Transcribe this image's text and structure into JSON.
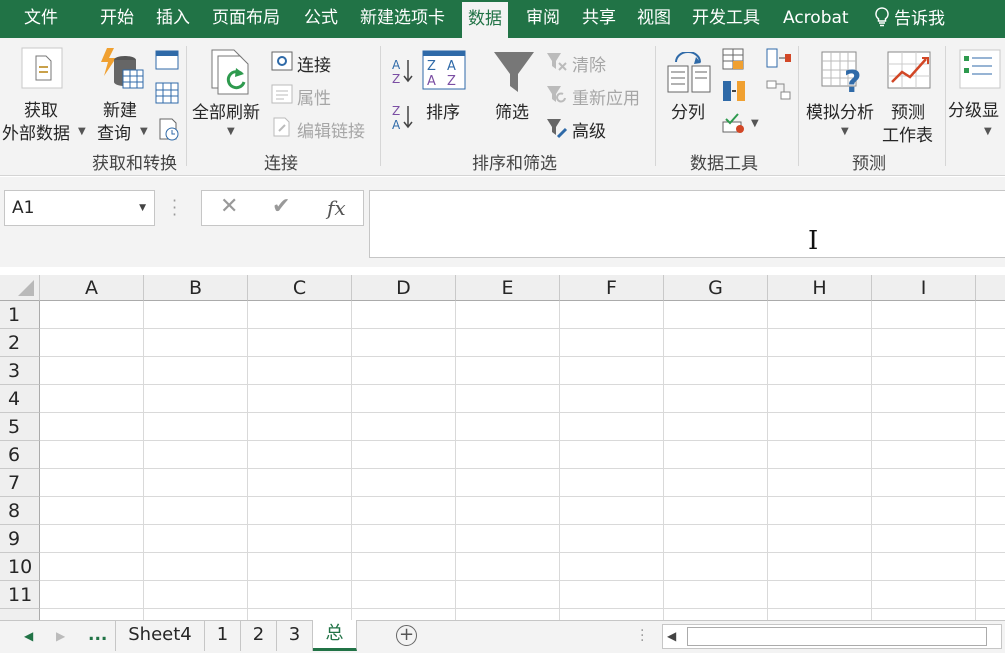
{
  "menu": {
    "tabs": [
      {
        "label": "文件"
      },
      {
        "label": "开始"
      },
      {
        "label": "插入"
      },
      {
        "label": "页面布局"
      },
      {
        "label": "公式"
      },
      {
        "label": "新建选项卡"
      },
      {
        "label": "数据"
      },
      {
        "label": "审阅"
      },
      {
        "label": "共享"
      },
      {
        "label": "视图"
      },
      {
        "label": "开发工具"
      },
      {
        "label": "Acrobat"
      }
    ],
    "active_tab": "数据",
    "tell_me": "告诉我"
  },
  "ribbon": {
    "get_external_data": "获取\n外部数据",
    "get_external_data_l1": "获取",
    "get_external_data_l2": "外部数据",
    "new_query_l1": "新建",
    "new_query_l2": "查询",
    "group_get_transform": "获取和转换",
    "refresh_all": "全部刷新",
    "connections": "连接",
    "properties": "属性",
    "edit_links": "编辑链接",
    "group_connections": "连接",
    "sort": "排序",
    "filter": "筛选",
    "clear": "清除",
    "reapply": "重新应用",
    "advanced": "高级",
    "group_sort_filter": "排序和筛选",
    "text_to_columns": "分列",
    "group_data_tools": "数据工具",
    "what_if_l1": "模拟分析",
    "forecast_l1": "预测",
    "forecast_l2": "工作表",
    "group_forecast": "预测",
    "outline": "分级显",
    "accent": "#217346"
  },
  "formula_bar": {
    "name_box": "A1",
    "formula": ""
  },
  "grid": {
    "columns": [
      "A",
      "B",
      "C",
      "D",
      "E",
      "F",
      "G",
      "H",
      "I"
    ],
    "rows": [
      "1",
      "2",
      "3",
      "4",
      "5",
      "6",
      "7",
      "8",
      "9",
      "10",
      "11"
    ]
  },
  "sheets": {
    "ellipsis": "...",
    "tabs": [
      {
        "label": "Sheet4"
      },
      {
        "label": "1"
      },
      {
        "label": "2"
      },
      {
        "label": "3"
      },
      {
        "label": "总"
      }
    ],
    "active_sheet": "总"
  }
}
